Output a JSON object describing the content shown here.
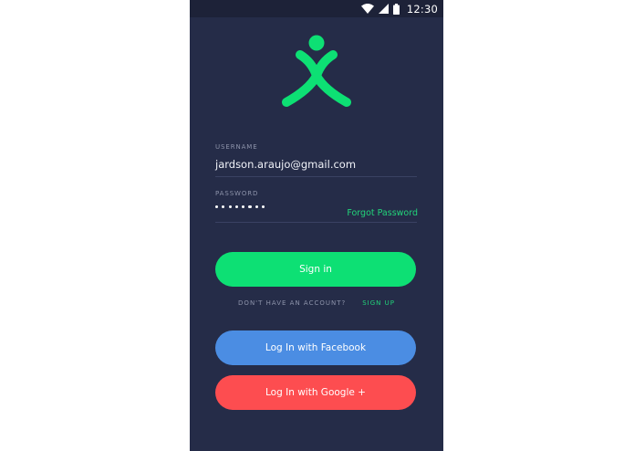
{
  "status_bar": {
    "time": "12:30",
    "icons": [
      "wifi-icon",
      "cellular-signal-icon",
      "battery-icon"
    ]
  },
  "logo": {
    "icon": "person-logo-icon",
    "color": "#0de074"
  },
  "form": {
    "username_label": "USERNAME",
    "username_value": "jardson.araujo@gmail.com",
    "password_label": "PASSWORD",
    "password_masked_length": 8,
    "forgot_password": "Forgot Password"
  },
  "buttons": {
    "signin": "Sign in",
    "facebook": "Log In with Facebook",
    "google": "Log In with Google +"
  },
  "account_prompt": {
    "text": "DON'T HAVE AN ACCOUNT?",
    "signup": "SIGN UP"
  },
  "colors": {
    "background": "#252c48",
    "status_bar": "#1d2238",
    "accent_green": "#0de074",
    "facebook_blue": "#4b8de3",
    "google_red": "#fd4d50"
  }
}
